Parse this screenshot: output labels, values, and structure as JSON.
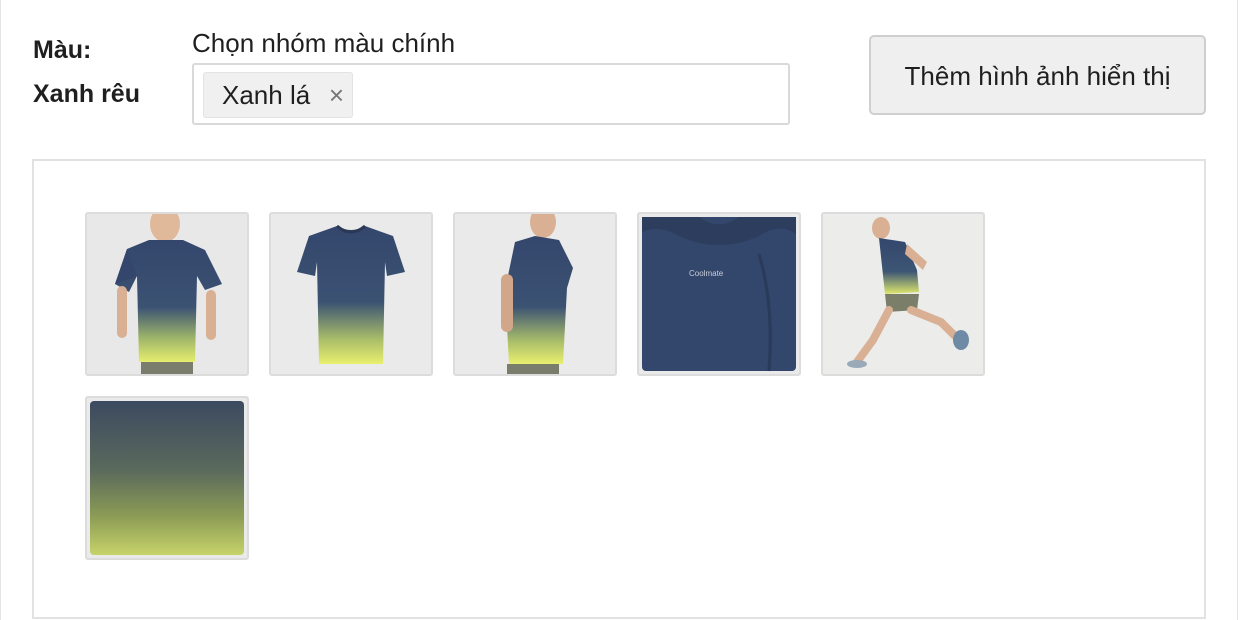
{
  "color_label": "Màu:\nXanh rêu",
  "color_label_line1": "Màu:",
  "color_label_line2": "Xanh rêu",
  "group_select": {
    "label": "Chọn nhóm màu chính",
    "selected": [
      "Xanh lá"
    ],
    "remove_icon": "close-icon"
  },
  "add_button": {
    "label": "Thêm hình ảnh hiển thị"
  },
  "gallery": {
    "images": [
      {
        "name": "model-front-photo"
      },
      {
        "name": "shirt-flat-photo"
      },
      {
        "name": "model-side-photo"
      },
      {
        "name": "fabric-logo-closeup"
      },
      {
        "name": "running-model-photo"
      },
      {
        "name": "fabric-gradient-swatch"
      }
    ]
  },
  "colors": {
    "navy": "#33466b",
    "lime": "#e3ec6a",
    "border": "#e2e2e2",
    "button_bg": "#efefef"
  }
}
